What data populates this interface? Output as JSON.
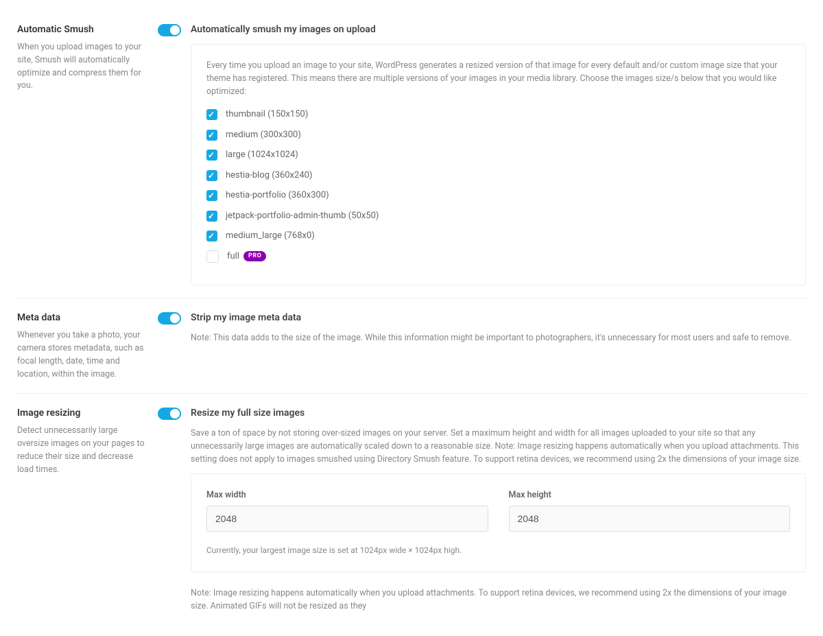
{
  "autoSmush": {
    "title": "Automatic Smush",
    "desc": "When you upload images to your site, Smush will automatically optimize and compress them for you.",
    "toggleLabel": "Automatically smush my images on upload",
    "intro": "Every time you upload an image to your site, WordPress generates a resized version of that image for every default and/or custom image size that your theme has registered. This means there are multiple versions of your images in your media library. Choose the images size/s below that you would like optimized:",
    "sizes": [
      {
        "label": "thumbnail (150x150)",
        "checked": true
      },
      {
        "label": "medium (300x300)",
        "checked": true
      },
      {
        "label": "large (1024x1024)",
        "checked": true
      },
      {
        "label": "hestia-blog (360x240)",
        "checked": true
      },
      {
        "label": "hestia-portfolio (360x300)",
        "checked": true
      },
      {
        "label": "jetpack-portfolio-admin-thumb (50x50)",
        "checked": true
      },
      {
        "label": "medium_large (768x0)",
        "checked": true
      },
      {
        "label": "full",
        "checked": false,
        "pro": true
      }
    ],
    "proBadge": "PRO"
  },
  "meta": {
    "title": "Meta data",
    "desc": "Whenever you take a photo, your camera stores metadata, such as focal length, date, time and location, within the image.",
    "toggleLabel": "Strip my image meta data",
    "note": "Note: This data adds to the size of the image. While this information might be important to photographers, it's unnecessary for most users and safe to remove."
  },
  "resize": {
    "title": "Image resizing",
    "desc": "Detect unnecessarily large oversize images on your pages to reduce their size and decrease load times.",
    "toggleLabel": "Resize my full size images",
    "explain": "Save a ton of space by not storing over-sized images on your server. Set a maximum height and width for all images uploaded to your site so that any unnecessarily large images are automatically scaled down to a reasonable size. Note: Image resizing happens automatically when you upload attachments. This setting does not apply to images smushed using Directory Smush feature. To support retina devices, we recommend using 2x the dimensions of your image size.",
    "maxWidthLabel": "Max width",
    "maxWidth": "2048",
    "maxHeightLabel": "Max height",
    "maxHeight": "2048",
    "current": "Currently, your largest image size is set at 1024px wide × 1024px high.",
    "bottomNote": "Note: Image resizing happens automatically when you upload attachments. To support retina devices, we recommend using 2x the dimensions of your image size. Animated GIFs will not be resized as they"
  }
}
